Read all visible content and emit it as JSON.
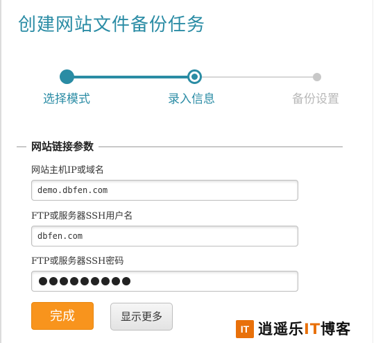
{
  "page": {
    "title": "创建网站文件备份任务"
  },
  "steps": [
    {
      "label": "选择模式",
      "state": "done"
    },
    {
      "label": "录入信息",
      "state": "current"
    },
    {
      "label": "备份设置",
      "state": "pending"
    }
  ],
  "section": {
    "title": "网站链接参数"
  },
  "fields": {
    "host": {
      "label": "网站主机IP或域名",
      "value": "demo.dbfen.com"
    },
    "user": {
      "label": "FTP或服务器SSH用户名",
      "value": "dbfen.com"
    },
    "password": {
      "label": "FTP或服务器SSH密码",
      "masked_length": 9
    }
  },
  "buttons": {
    "finish": "完成",
    "more": "显示更多"
  },
  "watermark": {
    "logo": "IT",
    "prefix": "逍遥乐",
    "highlight": "IT",
    "suffix": "博客"
  },
  "colors": {
    "accent": "#2a8ca4",
    "orange": "#f8941d",
    "inactive": "#c8c8c8"
  }
}
